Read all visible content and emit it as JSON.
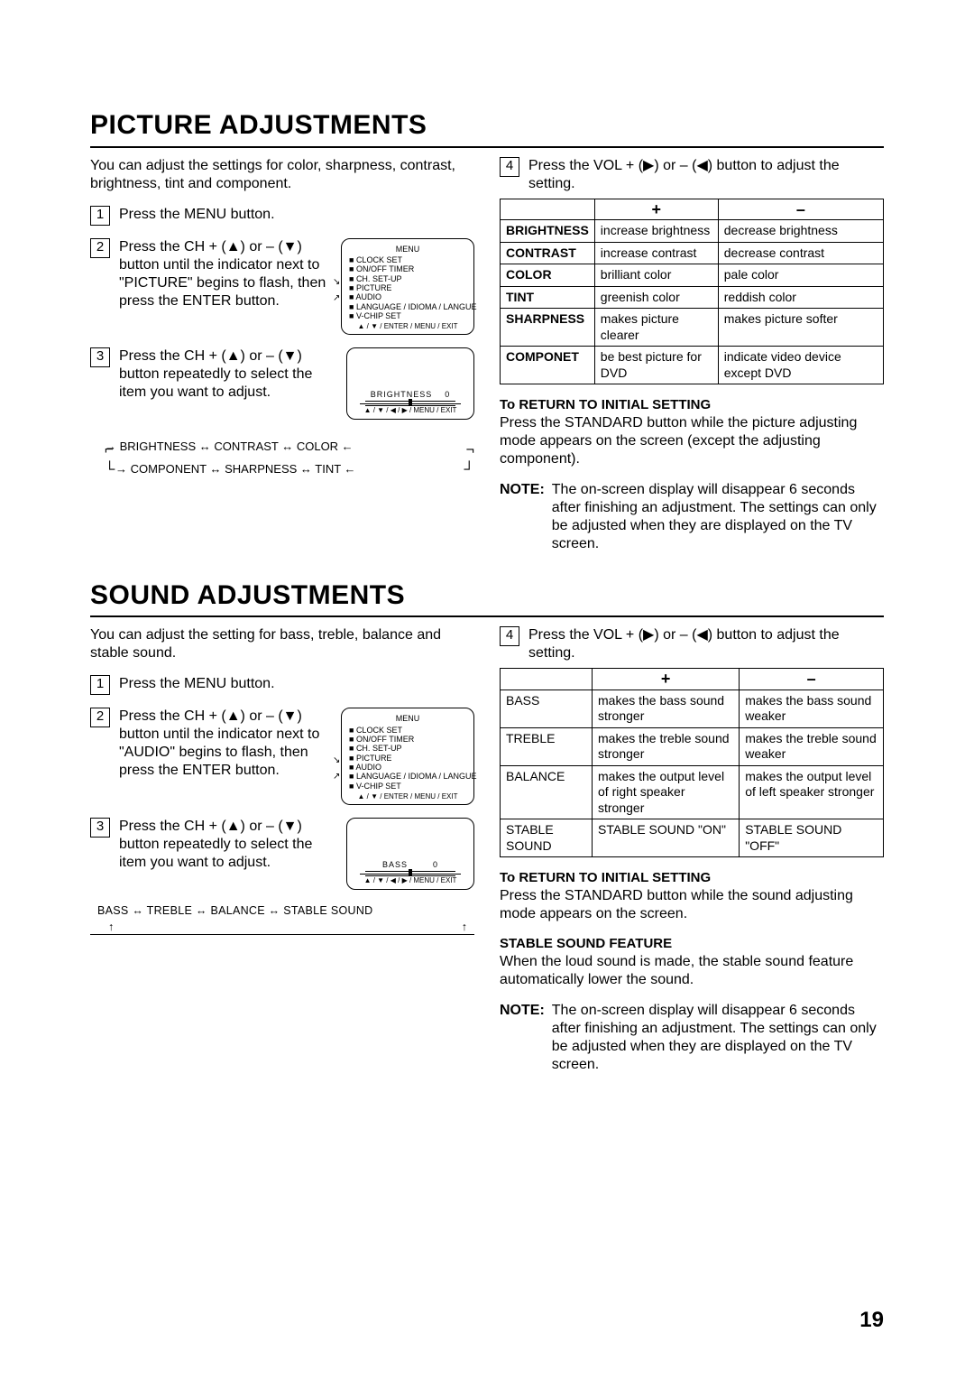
{
  "page_number": "19",
  "picture": {
    "heading": "PICTURE ADJUSTMENTS",
    "intro": "You can adjust the settings for color, sharpness, contrast, brightness, tint and component.",
    "step1": "Press the MENU button.",
    "step2": "Press the CH + (▲) or – (▼) button until the indicator next to \"PICTURE\" begins to flash, then press the ENTER button.",
    "step3": "Press the CH + (▲) or – (▼) button repeatedly to select the item you want to adjust.",
    "step4": "Press the VOL + (▶) or – (◀)  button to adjust the setting.",
    "osd_menu": {
      "title": "MENU",
      "items": [
        "CLOCK SET",
        "ON/OFF TIMER",
        "CH. SET-UP",
        "PICTURE",
        "AUDIO",
        "LANGUAGE / IDIOMA / LANGUE",
        "V-CHIP SET"
      ],
      "footer": "▲ / ▼ / ENTER / MENU / EXIT"
    },
    "osd_level": {
      "label": "BRIGHTNESS",
      "value": "0",
      "footer": "▲ / ▼ / ◀ / ▶ / MENU / EXIT"
    },
    "cycle_l1": "→  BRIGHTNESS  ↔  CONTRAST  ↔  COLOR  ←",
    "cycle_l2": "→  COMPONENT  ↔  SHARPNESS  ↔  TINT  ←",
    "table": {
      "plus": "+",
      "minus": "–",
      "rows": [
        {
          "h": "BRIGHTNESS",
          "p": "increase brightness",
          "m": "decrease brightness"
        },
        {
          "h": "CONTRAST",
          "p": "increase contrast",
          "m": "decrease contrast"
        },
        {
          "h": "COLOR",
          "p": "brilliant color",
          "m": "pale color"
        },
        {
          "h": "TINT",
          "p": "greenish color",
          "m": "reddish color"
        },
        {
          "h": "SHARPNESS",
          "p": "makes picture clearer",
          "m": "makes picture softer"
        },
        {
          "h": "COMPONET",
          "p": "be best picture for DVD",
          "m": "indicate video device except DVD"
        }
      ]
    },
    "return_head": "To RETURN TO INITIAL SETTING",
    "return_body": "Press the STANDARD button while the picture adjusting mode appears on the screen (except the adjusting component).",
    "note_label": "NOTE:",
    "note_body": "The on-screen display will disappear 6 seconds after finishing an adjustment. The settings can only be adjusted when they are displayed on the TV screen."
  },
  "sound": {
    "heading": "SOUND ADJUSTMENTS",
    "intro": "You can adjust the setting for bass, treble, balance and stable sound.",
    "step1": "Press the MENU button.",
    "step2": "Press the CH + (▲) or – (▼) button until the indicator next to \"AUDIO\" begins to flash, then press the ENTER button.",
    "step3": "Press the CH + (▲) or – (▼) button repeatedly to select the item you want to adjust.",
    "step4": "Press the VOL + (▶) or – (◀)  button to adjust the setting.",
    "osd_menu": {
      "title": "MENU",
      "items": [
        "CLOCK SET",
        "ON/OFF TIMER",
        "CH. SET-UP",
        "PICTURE",
        "AUDIO",
        "LANGUAGE / IDIOMA / LANGUE",
        "V-CHIP SET"
      ],
      "footer": "▲ / ▼ / ENTER / MENU / EXIT"
    },
    "osd_level": {
      "label": "BASS",
      "value": "0",
      "footer": "▲ / ▼ / ◀ / ▶ / MENU / EXIT"
    },
    "cycle": "BASS  ↔  TREBLE ↔  BALANCE  ↔  STABLE SOUND",
    "table": {
      "plus": "+",
      "minus": "–",
      "rows": [
        {
          "h": "BASS",
          "p": "makes the bass sound stronger",
          "m": "makes the bass sound weaker"
        },
        {
          "h": "TREBLE",
          "p": "makes the treble sound stronger",
          "m": "makes the treble sound weaker"
        },
        {
          "h": "BALANCE",
          "p": "makes the output level of right speaker stronger",
          "m": "makes the output level of left speaker stronger"
        },
        {
          "h": "STABLE SOUND",
          "p": "STABLE SOUND \"ON\"",
          "m": "STABLE SOUND \"OFF\""
        }
      ]
    },
    "return_head": "To RETURN TO INITIAL SETTING",
    "return_body": "Press the STANDARD button while the sound adjusting mode appears on the screen.",
    "stable_head": "STABLE SOUND FEATURE",
    "stable_body": "When the loud sound is made, the stable sound feature automatically lower the sound.",
    "note_label": "NOTE:",
    "note_body": "The on-screen display will disappear 6 seconds after finishing an adjustment. The settings can only be adjusted when they are displayed on the TV screen."
  }
}
